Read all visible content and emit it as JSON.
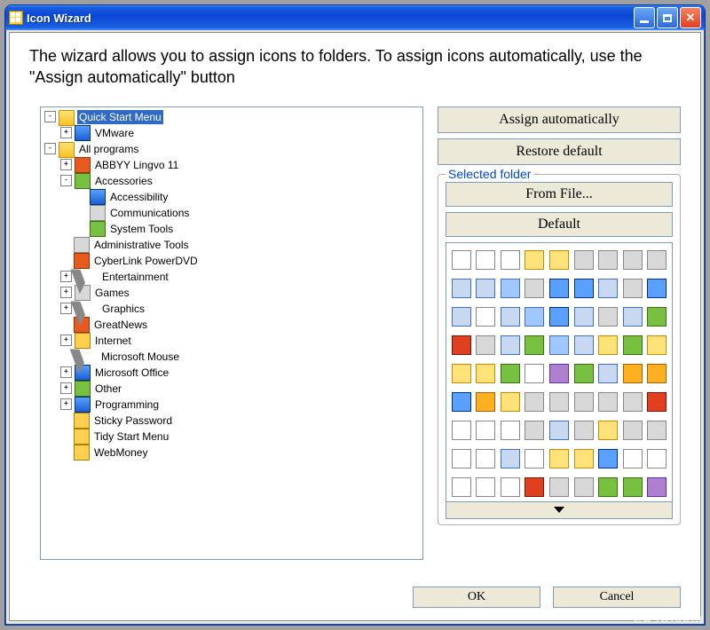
{
  "window": {
    "title": "Icon Wizard"
  },
  "intro": "The wizard allows you to assign icons to folders. To assign icons automatically, use the \"Assign automatically\" button",
  "tree": {
    "items": [
      {
        "lvl": 0,
        "exp": "-",
        "icon": "folder",
        "label": "Quick Start Menu",
        "selected": true
      },
      {
        "lvl": 1,
        "exp": "+",
        "icon": "wblue",
        "label": "VMware"
      },
      {
        "lvl": 0,
        "exp": "-",
        "icon": "folder",
        "label": "All programs"
      },
      {
        "lvl": 1,
        "exp": "+",
        "icon": "ored",
        "label": "ABBYY Lingvo 11"
      },
      {
        "lvl": 1,
        "exp": "-",
        "icon": "green",
        "label": "Accessories"
      },
      {
        "lvl": 2,
        "exp": "",
        "icon": "wblue",
        "label": "Accessibility"
      },
      {
        "lvl": 2,
        "exp": "",
        "icon": "grey-ico",
        "label": "Communications"
      },
      {
        "lvl": 2,
        "exp": "",
        "icon": "green",
        "label": "System Tools"
      },
      {
        "lvl": 1,
        "exp": "",
        "icon": "grey-ico",
        "label": "Administrative Tools"
      },
      {
        "lvl": 1,
        "exp": "",
        "icon": "ored",
        "label": "CyberLink PowerDVD"
      },
      {
        "lvl": 1,
        "exp": "+",
        "icon": "cursor-ico",
        "label": "Entertainment"
      },
      {
        "lvl": 1,
        "exp": "+",
        "icon": "grey-ico",
        "label": "Games"
      },
      {
        "lvl": 1,
        "exp": "+",
        "icon": "cursor-ico",
        "label": "Graphics"
      },
      {
        "lvl": 1,
        "exp": "",
        "icon": "ored",
        "label": "GreatNews"
      },
      {
        "lvl": 1,
        "exp": "+",
        "icon": "yel",
        "label": "Internet"
      },
      {
        "lvl": 1,
        "exp": "",
        "icon": "cursor-ico",
        "label": "Microsoft Mouse"
      },
      {
        "lvl": 1,
        "exp": "+",
        "icon": "wblue",
        "label": "Microsoft Office"
      },
      {
        "lvl": 1,
        "exp": "+",
        "icon": "green",
        "label": "Other"
      },
      {
        "lvl": 1,
        "exp": "+",
        "icon": "wblue",
        "label": "Programming"
      },
      {
        "lvl": 1,
        "exp": "",
        "icon": "yel",
        "label": "Sticky Password"
      },
      {
        "lvl": 1,
        "exp": "",
        "icon": "yel",
        "label": "Tidy Start Menu"
      },
      {
        "lvl": 1,
        "exp": "",
        "icon": "yel",
        "label": "WebMoney"
      }
    ]
  },
  "buttons": {
    "assign_auto": "Assign automatically",
    "restore_default": "Restore default",
    "from_file": "From File...",
    "default_btn": "Default",
    "ok": "OK",
    "cancel": "Cancel"
  },
  "group": {
    "title": "Selected folder"
  },
  "icon_grid": {
    "count": 81,
    "palette": [
      "s0",
      "s0",
      "s0",
      "s1",
      "s1",
      "s6",
      "s6",
      "s6",
      "s6",
      "s2",
      "s2",
      "s9",
      "s6",
      "s3",
      "s3",
      "s2",
      "s6",
      "s3",
      "s2",
      "s0",
      "s2",
      "s9",
      "s3",
      "s2",
      "s6",
      "s2",
      "s4",
      "s5",
      "s6",
      "s2",
      "s4",
      "s9",
      "s2",
      "s1",
      "s4",
      "s1",
      "s1",
      "s1",
      "s4",
      "s0",
      "s8",
      "s4",
      "s2",
      "s7",
      "s7",
      "s3",
      "s7",
      "s1",
      "s6",
      "s6",
      "s6",
      "s6",
      "s6",
      "s5",
      "s0",
      "s0",
      "s0",
      "s6",
      "s2",
      "s6",
      "s1",
      "s6",
      "s6",
      "s0",
      "s0",
      "s2",
      "s0",
      "s1",
      "s1",
      "s3",
      "s0",
      "s0",
      "s0",
      "s0",
      "s0",
      "s5",
      "s6",
      "s6",
      "s4",
      "s4",
      "s8"
    ]
  },
  "watermark": "LO4D.com"
}
